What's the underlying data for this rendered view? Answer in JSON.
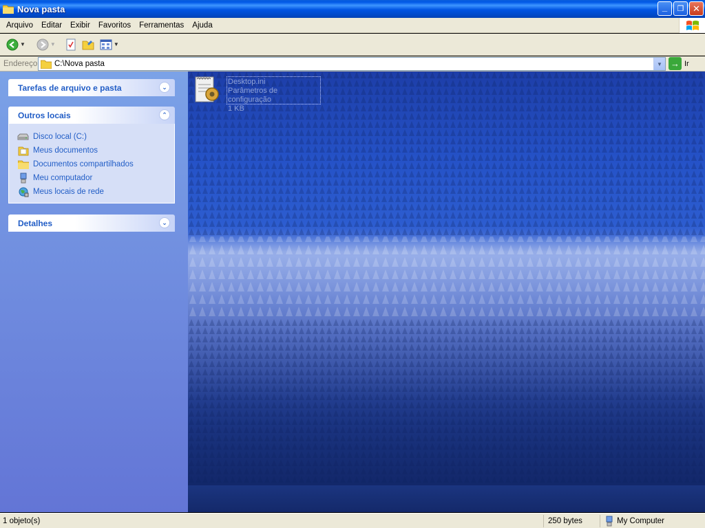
{
  "window": {
    "title": "Nova pasta",
    "buttons": {
      "minimize": "_",
      "maximize": "❐",
      "close": "✕"
    }
  },
  "menubar": {
    "items": [
      {
        "label": "Arquivo"
      },
      {
        "label": "Editar"
      },
      {
        "label": "Exibir"
      },
      {
        "label": "Favoritos"
      },
      {
        "label": "Ferramentas"
      },
      {
        "label": "Ajuda"
      }
    ]
  },
  "toolbar": {
    "back_icon": "back-arrow-icon",
    "forward_icon": "forward-arrow-icon"
  },
  "address": {
    "label": "Endereço",
    "value": "C:\\Nova pasta",
    "go_label": "Ir"
  },
  "sidebar": {
    "panels": [
      {
        "title": "Tarefas de arquivo e pasta",
        "expanded": false
      },
      {
        "title": "Outros locais",
        "expanded": true,
        "items": [
          {
            "label": "Disco local (C:)",
            "icon": "hard-drive-icon"
          },
          {
            "label": "Meus documentos",
            "icon": "my-documents-icon"
          },
          {
            "label": "Documentos compartilhados",
            "icon": "folder-icon"
          },
          {
            "label": "Meu computador",
            "icon": "computer-icon"
          },
          {
            "label": "Meus locais de rede",
            "icon": "network-icon"
          }
        ]
      },
      {
        "title": "Detalhes",
        "expanded": false
      }
    ]
  },
  "file": {
    "name": "Desktop.ini",
    "type": "Parâmetros de configuração",
    "size": "1 KB"
  },
  "statusbar": {
    "objects": "1 objeto(s)",
    "size": "250 bytes",
    "zone": "My Computer"
  }
}
